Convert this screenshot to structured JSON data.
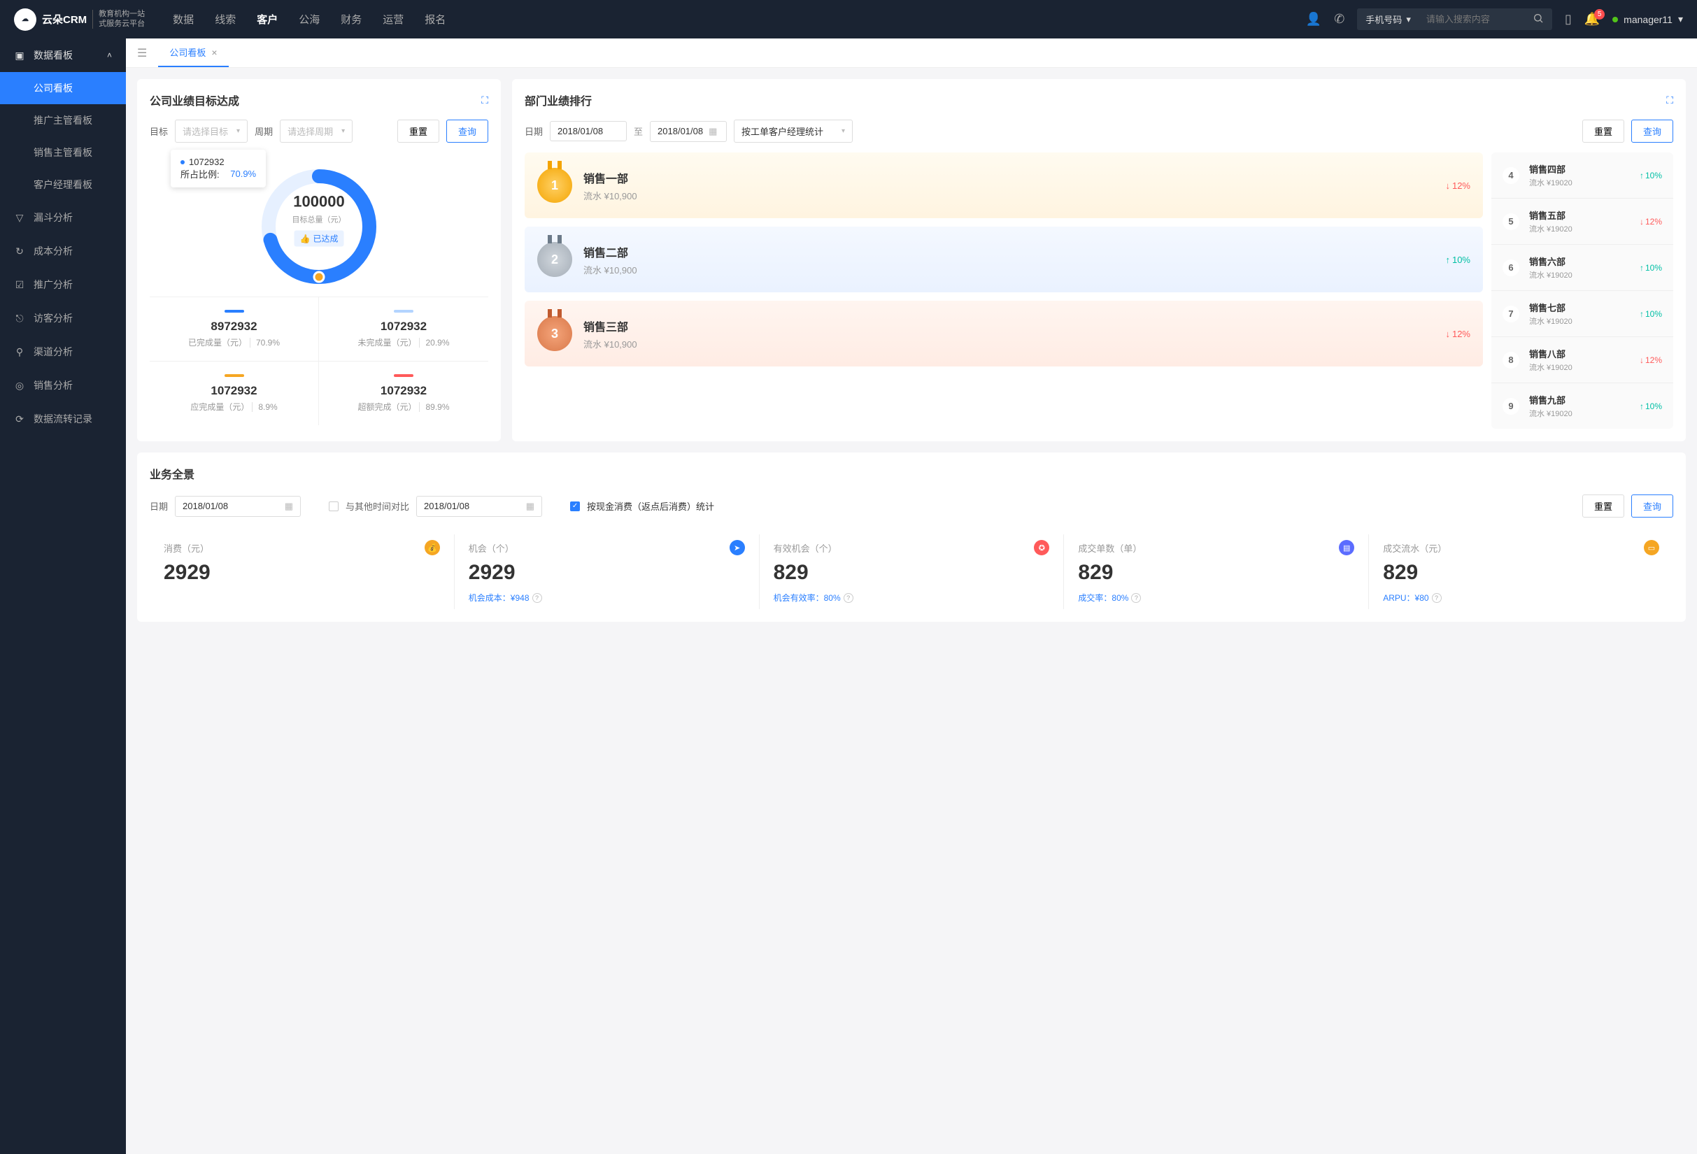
{
  "brand": {
    "name": "云朵CRM",
    "tagline_l1": "教育机构一站",
    "tagline_l2": "式服务云平台"
  },
  "topnav": {
    "items": [
      "数据",
      "线索",
      "客户",
      "公海",
      "财务",
      "运营",
      "报名"
    ],
    "active": "客户"
  },
  "search": {
    "type": "手机号码",
    "placeholder": "请输入搜索内容"
  },
  "notifications": {
    "count": "5"
  },
  "user": {
    "name": "manager11"
  },
  "sidebar": {
    "group": {
      "label": "数据看板"
    },
    "subitems": [
      "公司看板",
      "推广主管看板",
      "销售主管看板",
      "客户经理看板"
    ],
    "active_sub": "公司看板",
    "items": [
      {
        "icon": "funnel-icon",
        "glyph": "▽",
        "label": "漏斗分析"
      },
      {
        "icon": "cost-icon",
        "glyph": "↻",
        "label": "成本分析"
      },
      {
        "icon": "promo-icon",
        "glyph": "☑",
        "label": "推广分析"
      },
      {
        "icon": "visitor-icon",
        "glyph": "⎋",
        "label": "访客分析"
      },
      {
        "icon": "channel-icon",
        "glyph": "⚲",
        "label": "渠道分析"
      },
      {
        "icon": "sales-icon",
        "glyph": "◎",
        "label": "销售分析"
      },
      {
        "icon": "flow-icon",
        "glyph": "⟳",
        "label": "数据流转记录"
      }
    ]
  },
  "tab": {
    "label": "公司看板"
  },
  "target_card": {
    "title": "公司业绩目标达成",
    "filters": {
      "target_label": "目标",
      "target_placeholder": "请选择目标",
      "period_label": "周期",
      "period_placeholder": "请选择周期",
      "reset": "重置",
      "query": "查询"
    },
    "tooltip": {
      "value": "1072932",
      "ratio_label": "所占比例:",
      "ratio": "70.9%"
    },
    "center": {
      "total": "100000",
      "label": "目标总量（元）",
      "badge": "已达成"
    },
    "stats": [
      {
        "color": "#2a7fff",
        "value": "8972932",
        "label": "已完成量（元）",
        "pct": "70.9%"
      },
      {
        "color": "#b3d4ff",
        "value": "1072932",
        "label": "未完成量（元）",
        "pct": "20.9%"
      },
      {
        "color": "#f5a623",
        "value": "1072932",
        "label": "应完成量（元）",
        "pct": "8.9%"
      },
      {
        "color": "#ff5a5a",
        "value": "1072932",
        "label": "超额完成（元）",
        "pct": "89.9%"
      }
    ]
  },
  "ranking_card": {
    "title": "部门业绩排行",
    "filters": {
      "date_label": "日期",
      "from": "2018/01/08",
      "sep": "至",
      "to": "2018/01/08",
      "group_by": "按工单客户经理统计",
      "reset": "重置",
      "query": "查询"
    },
    "top3": [
      {
        "rank": "1",
        "name": "销售一部",
        "rev": "流水 ¥10,900",
        "delta": "12%",
        "dir": "down"
      },
      {
        "rank": "2",
        "name": "销售二部",
        "rev": "流水 ¥10,900",
        "delta": "10%",
        "dir": "up"
      },
      {
        "rank": "3",
        "name": "销售三部",
        "rev": "流水 ¥10,900",
        "delta": "12%",
        "dir": "down"
      }
    ],
    "rest": [
      {
        "rank": "4",
        "name": "销售四部",
        "rev": "流水 ¥19020",
        "delta": "10%",
        "dir": "up"
      },
      {
        "rank": "5",
        "name": "销售五部",
        "rev": "流水 ¥19020",
        "delta": "12%",
        "dir": "down"
      },
      {
        "rank": "6",
        "name": "销售六部",
        "rev": "流水 ¥19020",
        "delta": "10%",
        "dir": "up"
      },
      {
        "rank": "7",
        "name": "销售七部",
        "rev": "流水 ¥19020",
        "delta": "10%",
        "dir": "up"
      },
      {
        "rank": "8",
        "name": "销售八部",
        "rev": "流水 ¥19020",
        "delta": "12%",
        "dir": "down"
      },
      {
        "rank": "9",
        "name": "销售九部",
        "rev": "流水 ¥19020",
        "delta": "10%",
        "dir": "up"
      }
    ]
  },
  "panorama_card": {
    "title": "业务全景",
    "filters": {
      "date_label": "日期",
      "date": "2018/01/08",
      "compare_label": "与其他时间对比",
      "date2": "2018/01/08",
      "check_label": "按现金消费（返点后消费）统计",
      "reset": "重置",
      "query": "查询"
    },
    "metrics": [
      {
        "label": "消费（元）",
        "icon_color": "#f5a623",
        "glyph": "💰",
        "value": "2929",
        "sub": ""
      },
      {
        "label": "机会（个）",
        "icon_color": "#2a7fff",
        "glyph": "➤",
        "value": "2929",
        "sub_label": "机会成本：",
        "sub_val": "¥948"
      },
      {
        "label": "有效机会（个）",
        "icon_color": "#ff5a5a",
        "glyph": "✪",
        "value": "829",
        "sub_label": "机会有效率：",
        "sub_val": "80%"
      },
      {
        "label": "成交单数（单）",
        "icon_color": "#5b6cff",
        "glyph": "▤",
        "value": "829",
        "sub_label": "成交率：",
        "sub_val": "80%"
      },
      {
        "label": "成交流水（元）",
        "icon_color": "#f5a623",
        "glyph": "▭",
        "value": "829",
        "sub_label": "ARPU：",
        "sub_val": "¥80"
      }
    ]
  },
  "chart_data": {
    "type": "pie",
    "title": "目标总量 100000 元",
    "categories": [
      "已完成量",
      "未完成量",
      "应完成量",
      "超额完成"
    ],
    "values": [
      8972932,
      1072932,
      1072932,
      1072932
    ],
    "percentages": [
      70.9,
      20.9,
      8.9,
      89.9
    ],
    "colors": [
      "#2a7fff",
      "#b3d4ff",
      "#f5a623",
      "#ff5a5a"
    ]
  }
}
